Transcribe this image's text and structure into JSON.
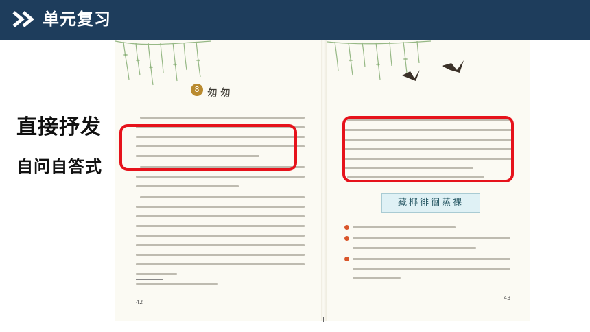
{
  "header": {
    "title": "单元复习",
    "background": "#1e3d5c",
    "icon": "double-chevron-right-icon"
  },
  "sidebar": {
    "heading": "直接抒发",
    "subheading": "自问自答式"
  },
  "book": {
    "lesson_number": "8",
    "lesson_title": "匆匆",
    "poem_title": "藏椰徘徊蒸裸",
    "left_page_number": "42",
    "right_page_number": "43",
    "highlight_color": "#e6121b"
  }
}
